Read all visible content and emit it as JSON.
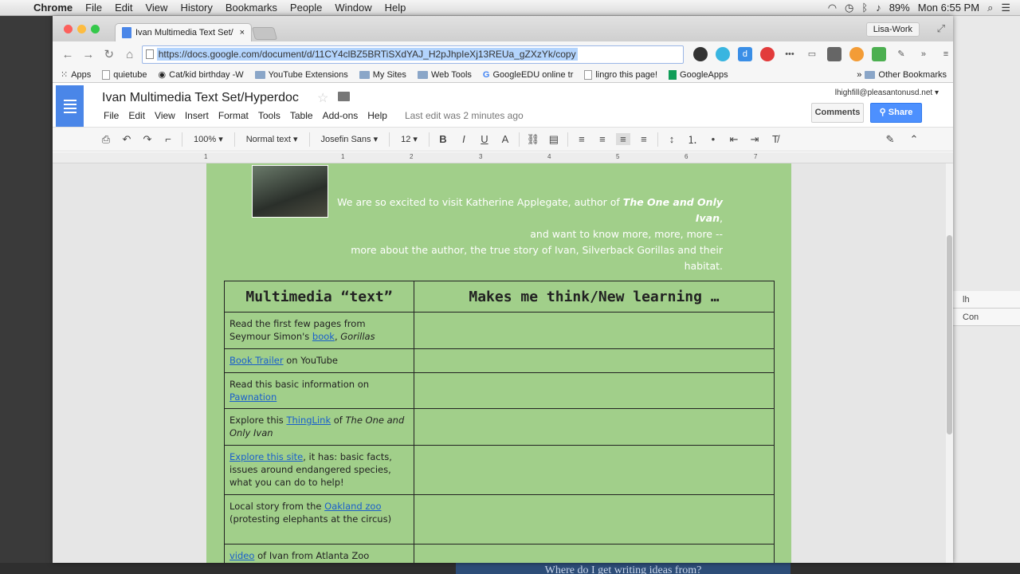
{
  "mac_menubar": {
    "app": "Chrome",
    "menus": [
      "File",
      "Edit",
      "View",
      "History",
      "Bookmarks",
      "People",
      "Window",
      "Help"
    ],
    "battery": "89%",
    "clock": "Mon 6:55 PM"
  },
  "browser": {
    "tab_title": "Ivan Multimedia Text Set/",
    "profile": "Lisa-Work",
    "url": "https://docs.google.com/document/d/11CY4clBZ5BRTiSXdYAJ_H2pJhpIeXj13REUa_gZXzYk/copy",
    "bookmarks": [
      "Apps",
      "quietube",
      "Cat/kid birthday -W",
      "YouTube Extensions",
      "My Sites",
      "Web Tools",
      "GoogleEDU online tr",
      "lingro this page!",
      "GoogleApps",
      "Other Bookmarks"
    ]
  },
  "docs": {
    "title": "Ivan Multimedia Text Set/Hyperdoc",
    "menu": [
      "File",
      "Edit",
      "View",
      "Insert",
      "Format",
      "Tools",
      "Table",
      "Add-ons",
      "Help"
    ],
    "last_edit": "Last edit was 2 minutes ago",
    "account": "lhighfill@pleasantonusd.net",
    "comments_label": "Comments",
    "share_label": "Share",
    "zoom": "100%",
    "style": "Normal text",
    "font": "Josefin Sans",
    "size": "12",
    "ruler_ticks": [
      "1",
      "1",
      "2",
      "3",
      "4",
      "5",
      "6",
      "7"
    ]
  },
  "content": {
    "intro_line1a": "We are so excited to visit Katherine Applegate, author of ",
    "intro_line1b": "The One and Only Ivan",
    "intro_line1c": ",",
    "intro_line2": "and want to know more, more, more --",
    "intro_line3": "more about the author, the true story of Ivan, Silverback Gorillas and their habitat.",
    "table_headers": [
      "Multimedia “text”",
      "Makes me think/New learning …"
    ],
    "rows": {
      "r1a": "Read the first few pages from Seymour Simon's ",
      "r1link": "book",
      "r1b": ", ",
      "r1it": "Gorillas",
      "r2link": "Book Trailer",
      "r2b": " on YouTube",
      "r3a": "Read this basic information on ",
      "r3link": "Pawnation",
      "r4a": "Explore this ",
      "r4link": "ThingLink",
      "r4b": " of ",
      "r4it": "The One and Only Ivan",
      "r5link": "Explore this site",
      "r5b": ", it has: basic facts, issues around endangered species, what you can do to help!",
      "r6a": "Local story from the ",
      "r6link": "Oakland zoo",
      "r6b": "(protesting elephants at the circus)",
      "r7link": "video",
      "r7b": " of Ivan from Atlanta Zoo"
    }
  },
  "backdrop": {
    "slide_text": "Where do I get writing ideas from?",
    "side_texts": [
      "lh",
      "Con"
    ]
  }
}
